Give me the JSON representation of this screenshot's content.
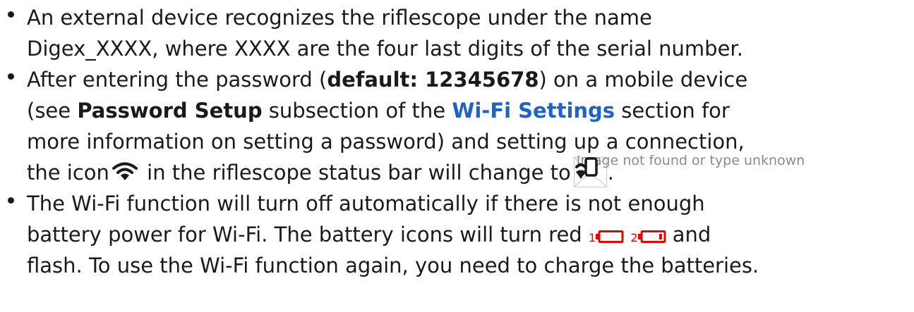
{
  "bullets": {
    "b1": {
      "line1": "An external device recognizes the riflescope under the name",
      "line2": "Digex_XXXX, where XXXX are the four last digits of the serial number."
    },
    "b2": {
      "line1_pre": "After entering the password (",
      "line1_bold": "default: 12345678",
      "line1_post": ") on a mobile device",
      "line2_pre": "(see ",
      "line2_bold": "Password Setup",
      "line2_mid": " subsection of the ",
      "line2_link": "Wi-Fi Settings",
      "line2_post": " section for",
      "line3": "more information on setting a password) and setting up a connection,",
      "line4_pre": "the icon",
      "line4_mid": " in the riflescope status bar will change to",
      "broken_image_text": "Image not found or type unknown",
      "line4_post": "."
    },
    "b3": {
      "line1": "The Wi-Fi function will turn off automatically if there is not enough",
      "line2_pre": "battery power for Wi-Fi. The battery icons will turn red",
      "battery1_num": "1",
      "battery2_num": "2",
      "line2_post": " and",
      "line3": "flash. To use the Wi-Fi function again, you need to charge the batteries."
    }
  },
  "icons": {
    "wifi": "wifi-icon",
    "wifi_phone": "wifi-phone-icon",
    "broken_image": "broken-image-icon",
    "battery": "battery-icon"
  },
  "colors": {
    "text": "#1a1a1a",
    "link": "#1f63c6",
    "battery_red": "#e10600",
    "broken_text": "#8a8a8a"
  }
}
